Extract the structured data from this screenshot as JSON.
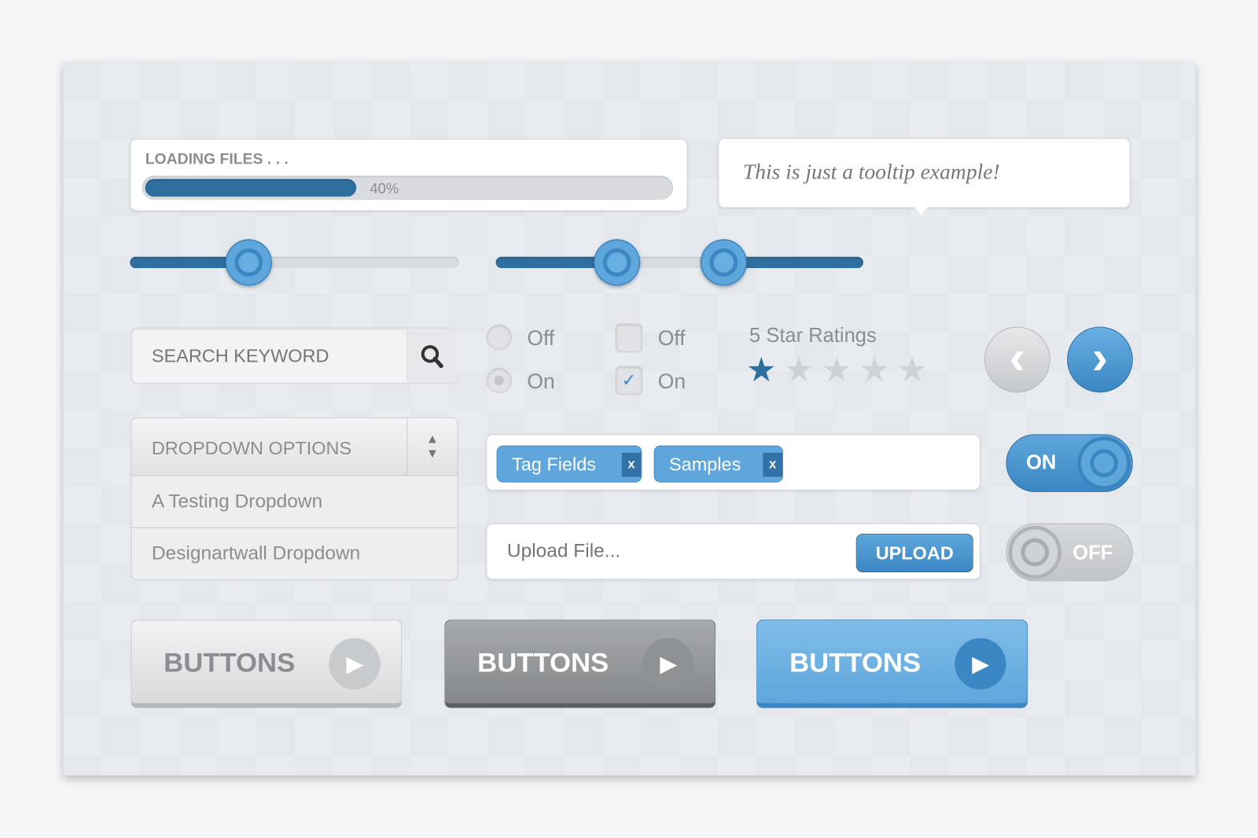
{
  "progress": {
    "label": "LOADING FILES . . .",
    "value_percent": 40,
    "value_text": "40%"
  },
  "tooltip": {
    "text": "This is just a tooltip example!"
  },
  "slider": {
    "value_percent": 36
  },
  "range_slider": {
    "low_percent": 33,
    "high_percent": 62
  },
  "search": {
    "placeholder": "SEARCH KEYWORD",
    "icon": "search-icon"
  },
  "radios": [
    {
      "label": "Off",
      "checked": false
    },
    {
      "label": "On",
      "checked": true
    }
  ],
  "checkboxes": [
    {
      "label": "Off",
      "checked": false
    },
    {
      "label": "On",
      "checked": true,
      "mark": "✓"
    }
  ],
  "rating": {
    "label": "5 Star Ratings",
    "value": 1,
    "max": 5,
    "active_color": "#2f6f9f"
  },
  "pager": {
    "prev_icon": "chevron-left-icon",
    "next_icon": "chevron-right-icon",
    "prev": "‹",
    "next": "›"
  },
  "dropdown": {
    "selected": "DROPDOWN OPTIONS",
    "options": [
      "A Testing Dropdown",
      "Designartwall Dropdown"
    ]
  },
  "tags": {
    "items": [
      {
        "label": "Tag Fields",
        "remove": "x"
      },
      {
        "label": "Samples",
        "remove": "x"
      }
    ]
  },
  "toggles": {
    "on_label": "ON",
    "off_label": "OFF"
  },
  "upload": {
    "placeholder": "Upload File...",
    "button": "UPLOAD"
  },
  "buttons": [
    {
      "label": "BUTTONS",
      "style": "light"
    },
    {
      "label": "BUTTONS",
      "style": "dark"
    },
    {
      "label": "BUTTONS",
      "style": "blue"
    }
  ],
  "colors": {
    "accent": "#5ea6dc",
    "accent_dark": "#2f6f9f",
    "panel": "#e4e8ec"
  }
}
